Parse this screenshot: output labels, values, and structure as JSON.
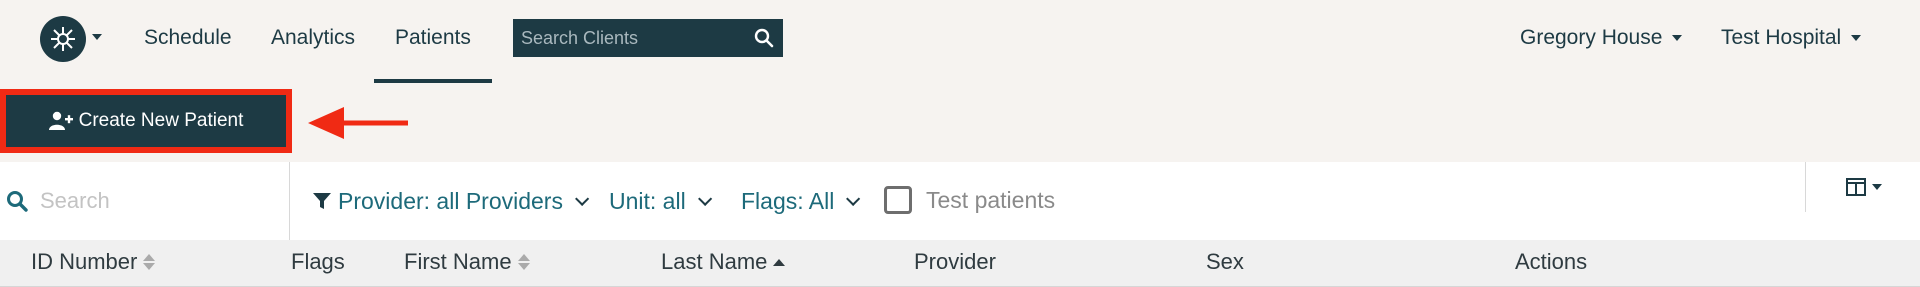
{
  "nav": {
    "items": [
      {
        "label": "Schedule"
      },
      {
        "label": "Analytics"
      },
      {
        "label": "Patients",
        "active": true
      }
    ],
    "search_placeholder": "Search Clients",
    "user_menu": "Gregory House",
    "org_menu": "Test Hospital"
  },
  "actions": {
    "create_patient_label": "Create New Patient",
    "highlight_color": "#f02a14"
  },
  "filters": {
    "search_placeholder": "Search",
    "provider_label": "Provider: all Providers",
    "unit_label": "Unit: all",
    "flags_label": "Flags: All",
    "test_patients_label": "Test patients",
    "test_patients_checked": false
  },
  "table": {
    "columns": [
      {
        "label": "ID Number",
        "sort": "both"
      },
      {
        "label": "Flags",
        "sort": "none"
      },
      {
        "label": "First Name",
        "sort": "both"
      },
      {
        "label": "Last Name",
        "sort": "asc"
      },
      {
        "label": "Provider",
        "sort": "none"
      },
      {
        "label": "Sex",
        "sort": "none"
      },
      {
        "label": "Actions",
        "sort": "none"
      }
    ]
  },
  "colors": {
    "primary": "#1d3a44",
    "background": "#f6f3f0",
    "link": "#1d6a7a"
  },
  "icons": {
    "logo": "logo-icon",
    "search_clients": "search-icon",
    "create_patient": "user-plus-icon",
    "filter": "filter-icon",
    "columns": "columns-icon"
  }
}
